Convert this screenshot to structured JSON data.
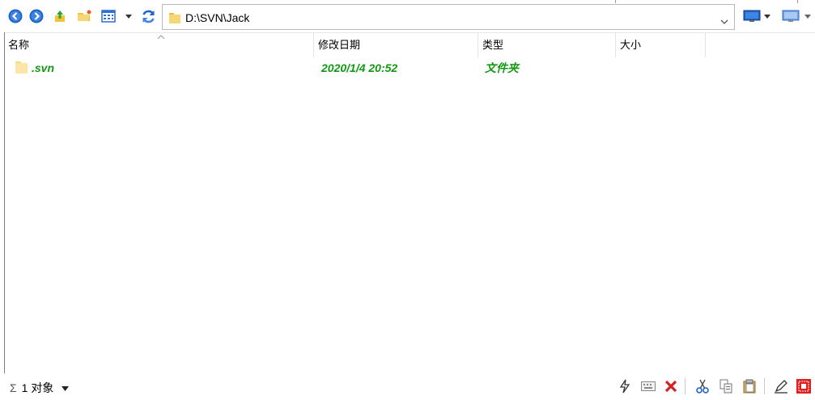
{
  "toolbar": {
    "back_icon": "back-arrow-icon",
    "forward_icon": "forward-arrow-icon",
    "up_icon": "up-folder-icon",
    "new_folder_icon": "new-folder-icon",
    "view_icon": "view-mode-icon",
    "refresh_icon": "refresh-icon"
  },
  "address": {
    "path": "D:\\SVN\\Jack"
  },
  "columns": {
    "name": "名称",
    "modified": "修改日期",
    "type": "类型",
    "size": "大小"
  },
  "files": [
    {
      "name": ".svn",
      "modified": "2020/1/4 20:52",
      "type": "文件夹",
      "size": ""
    }
  ],
  "status": {
    "sigma": "Σ",
    "count": "1 对象"
  },
  "colors": {
    "accent_green": "#119a11",
    "folder_yellow": "#f7d774"
  }
}
